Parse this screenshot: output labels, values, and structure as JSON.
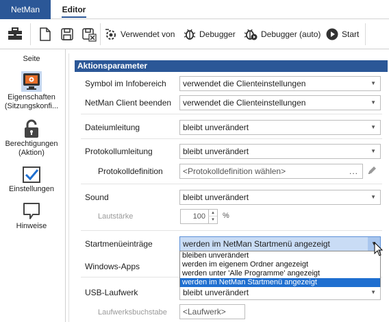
{
  "tabs": {
    "netman": "NetMan",
    "editor": "Editor"
  },
  "toolbar": {
    "verwendet_von": "Verwendet von",
    "debugger": "Debugger",
    "debugger_auto": "Debugger (auto)",
    "start": "Start"
  },
  "sidebar": {
    "heading": "Seite",
    "items": [
      {
        "label_line1": "Eigenschaften",
        "label_line2": "(Sitzungskonfi...",
        "icon": "monitor-gear-icon",
        "selected": true
      },
      {
        "label_line1": "Berechtigungen",
        "label_line2": "(Aktion)",
        "icon": "padlock-icon"
      },
      {
        "label_line1": "Einstellungen",
        "label_line2": "",
        "icon": "checkbox-check-icon"
      },
      {
        "label_line1": "Hinweise",
        "label_line2": "",
        "icon": "speech-bubble-icon"
      }
    ]
  },
  "section": {
    "title": "Aktionsparameter"
  },
  "fields": {
    "symbol": {
      "label": "Symbol im Infobereich",
      "value": "verwendet die Clienteinstellungen"
    },
    "client_beenden": {
      "label": "NetMan Client beenden",
      "value": "verwendet die Clienteinstellungen"
    },
    "dateiumleitung": {
      "label": "Dateiumleitung",
      "value": "bleibt unverändert"
    },
    "protokollumleitung": {
      "label": "Protokollumleitung",
      "value": "bleibt unverändert"
    },
    "protokolldefinition": {
      "label": "Protokolldefinition",
      "placeholder": "<Protokolldefinition wählen>",
      "ellipsis": "..."
    },
    "sound": {
      "label": "Sound",
      "value": "bleibt unverändert"
    },
    "lautstaerke": {
      "label": "Lautstärke",
      "value": "100",
      "unit": "%"
    },
    "startmenue": {
      "label": "Startmenüeinträge",
      "value": "werden im NetMan Startmenü angezeigt"
    },
    "windows_apps": {
      "label": "Windows-Apps"
    },
    "usb": {
      "label": "USB-Laufwerk",
      "value": "bleibt unverändert"
    },
    "laufwerksbuchstabe": {
      "label": "Laufwerksbuchstabe",
      "value": "<Laufwerk>"
    }
  },
  "dropdown": {
    "options": [
      "bleiben unverändert",
      "werden im eigenem Ordner angezeigt",
      "werden unter 'Alle Programme' angezeigt",
      "werden im NetMan Startmenü angezeigt"
    ],
    "selected_index": 3
  },
  "colors": {
    "accent": "#2b5797",
    "selection": "#1f6fd0",
    "active_combo": "#c9dcf5"
  }
}
